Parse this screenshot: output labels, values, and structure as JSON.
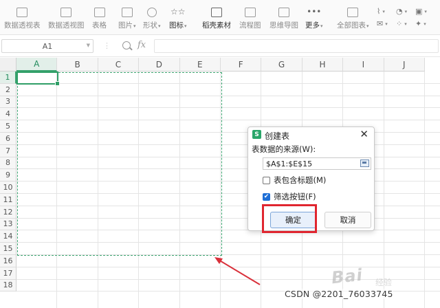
{
  "ribbon": {
    "items": [
      {
        "label": "数据透视表"
      },
      {
        "label": "数据透视图"
      },
      {
        "label": "表格"
      },
      {
        "label": "图片"
      },
      {
        "label": "形状"
      },
      {
        "label": "图标"
      },
      {
        "label": "稻壳素材"
      },
      {
        "label": "流程图"
      },
      {
        "label": "思维导图"
      },
      {
        "label": "更多"
      },
      {
        "label": "全部图表"
      }
    ]
  },
  "formula_bar": {
    "name_box": "A1",
    "fx": "fx"
  },
  "sheet": {
    "columns": [
      "A",
      "B",
      "C",
      "D",
      "E",
      "F",
      "G",
      "H",
      "I",
      "J"
    ],
    "rows": [
      "1",
      "2",
      "3",
      "4",
      "5",
      "6",
      "7",
      "8",
      "9",
      "10",
      "11",
      "12",
      "13",
      "14",
      "15",
      "16",
      "17",
      "18"
    ],
    "active_cell": "A1",
    "selected_range": "A1:E15"
  },
  "dialog": {
    "logo": "S",
    "title": "创建表",
    "close": "✕",
    "source_label": "表数据的来源(W):",
    "range_value": "$A$1:$E$15",
    "option_headers": {
      "label": "表包含标题(M)",
      "checked": false
    },
    "option_filter": {
      "label": "筛选按钮(F)",
      "checked": true
    },
    "ok_label": "确定",
    "cancel_label": "取消"
  },
  "watermark": {
    "text": "Bai",
    "sub": "经验"
  },
  "credit": "CSDN @2201_76033745",
  "colors": {
    "accent": "#2e9e66",
    "highlight": "#e0252f",
    "checkbox": "#1f6fd6"
  }
}
